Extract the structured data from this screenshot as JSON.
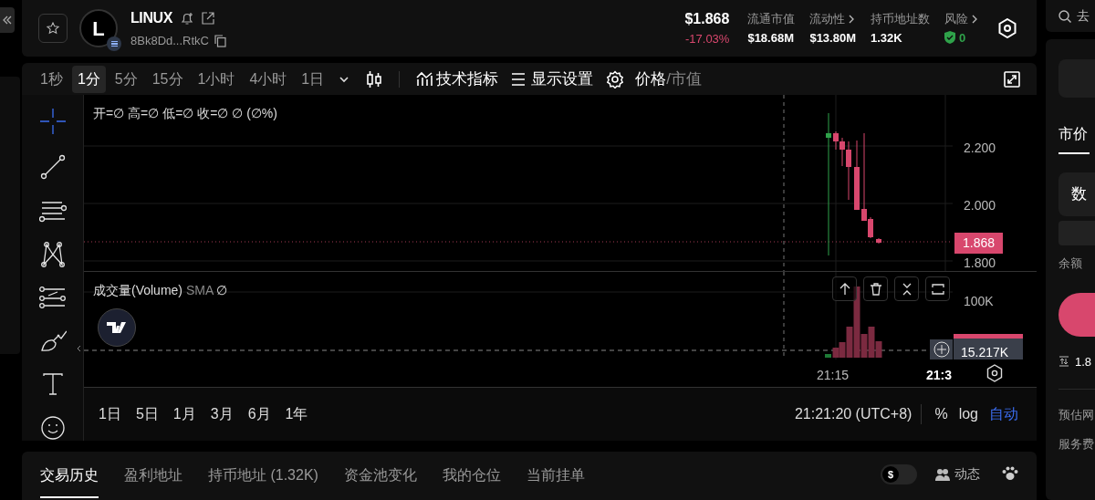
{
  "token": {
    "avatar_letter": "L",
    "name": "LINUX",
    "address": "8Bk8Dd...RtkC"
  },
  "price": {
    "value": "$1.868",
    "change": "-17.03%"
  },
  "stats": [
    {
      "label": "流通市值",
      "value": "$18.68M",
      "link": false,
      "kind": "plain"
    },
    {
      "label": "流动性",
      "value": "$13.80M",
      "link": true,
      "kind": "plain"
    },
    {
      "label": "持币地址数",
      "value": "1.32K",
      "link": false,
      "kind": "plain"
    },
    {
      "label": "风险",
      "value": "0",
      "link": true,
      "kind": "risk"
    }
  ],
  "intervals": [
    {
      "label": "1秒",
      "selected": false
    },
    {
      "label": "1分",
      "selected": true
    },
    {
      "label": "5分",
      "selected": false
    },
    {
      "label": "15分",
      "selected": false
    },
    {
      "label": "1小时",
      "selected": false
    },
    {
      "label": "4小时",
      "selected": false
    },
    {
      "label": "1日",
      "selected": false
    }
  ],
  "toolbar": [
    {
      "label": "技术指标",
      "kind": "indicators"
    },
    {
      "label": "显示设置",
      "kind": "display"
    }
  ],
  "value_mode": {
    "options": [
      {
        "label": "价格",
        "selected": true
      },
      {
        "label": "市值",
        "selected": false
      }
    ],
    "separator": "/"
  },
  "drawing_tools": [
    {
      "kind": "crosshair",
      "selected": true
    },
    {
      "kind": "line",
      "selected": false
    },
    {
      "kind": "parallel",
      "selected": false
    },
    {
      "kind": "pattern",
      "selected": false
    },
    {
      "kind": "fib",
      "selected": false
    },
    {
      "kind": "brush",
      "selected": false
    },
    {
      "kind": "text",
      "selected": false
    },
    {
      "kind": "emoji",
      "selected": false
    }
  ],
  "chart": {
    "legend": "开=∅ 高=∅ 低=∅ 收=∅ ∅ (∅%)",
    "price_ticks": [
      "2.200",
      "2.000",
      "1.800"
    ],
    "last_price": "1.868",
    "volume_legend": {
      "name": "成交量(Volume)",
      "ma": "SMA",
      "value": "∅"
    },
    "volume_ticks": [
      "100K"
    ],
    "last_volume": "15.217K",
    "time_ticks": [
      "21:15",
      "21:3"
    ]
  },
  "ranges": [
    {
      "label": "1日"
    },
    {
      "label": "5日"
    },
    {
      "label": "1月"
    },
    {
      "label": "3月"
    },
    {
      "label": "6月"
    },
    {
      "label": "1年"
    }
  ],
  "clock": "21:21:20 (UTC+8)",
  "scale_options": [
    {
      "label": "%",
      "selected": false
    },
    {
      "label": "log",
      "selected": false
    },
    {
      "label": "自动",
      "selected": true
    }
  ],
  "bottom_tabs": [
    {
      "label": "交易历史",
      "selected": true
    },
    {
      "label": "盈利地址",
      "selected": false
    },
    {
      "label": "持币地址 (1.32K)",
      "selected": false
    },
    {
      "label": "资金池变化",
      "selected": false
    },
    {
      "label": "我的仓位",
      "selected": false
    },
    {
      "label": "当前挂单",
      "selected": false
    }
  ],
  "bottom_actions": {
    "currency_toggle": {
      "symbol": "$",
      "on": false
    },
    "activity": "动态"
  },
  "right_panel": {
    "search": "去",
    "tab": "市价",
    "amount_label": "数",
    "balance_label": "余额",
    "info": "1.8",
    "estimate_label": "预估网",
    "fee_label": "服务费"
  }
}
